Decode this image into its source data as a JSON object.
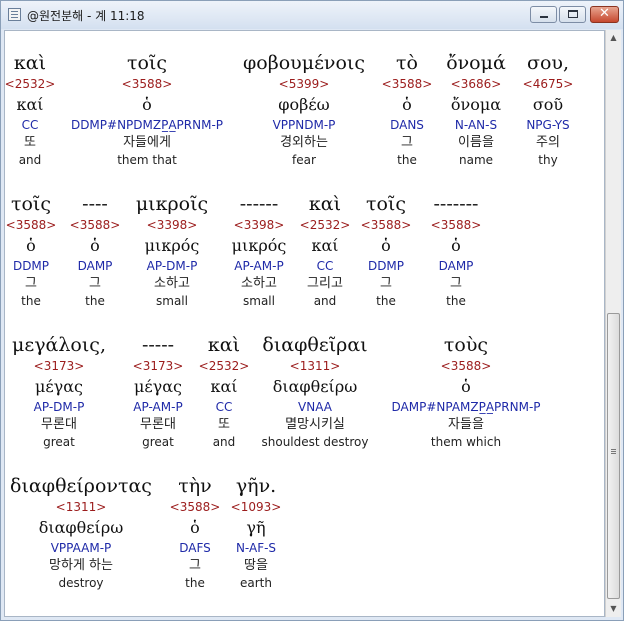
{
  "window": {
    "title": "@원전분해 - 계 11:18"
  },
  "rows": [
    [
      {
        "greek": "καὶ",
        "strong": "<2532>",
        "lemma": "καί",
        "parse": "CC",
        "korean": "또",
        "english": "and"
      },
      {
        "greek": "τοῖς",
        "strong": "<3588>",
        "lemma": "ὁ",
        "parse": "DDMP#NPDMZP̲A̲PRNM-P",
        "korean": "자들에게",
        "english": "them that"
      },
      {
        "greek": "φοβουμένοις",
        "strong": "<5399>",
        "lemma": "φοβέω",
        "parse": "VPPNDM-P",
        "korean": "경외하는",
        "english": "fear"
      },
      {
        "greek": "τὸ",
        "strong": "<3588>",
        "lemma": "ὁ",
        "parse": "DANS",
        "korean": "그",
        "english": "the"
      },
      {
        "greek": "ὄνομά",
        "strong": "<3686>",
        "lemma": "ὄνομα",
        "parse": "N-AN-S",
        "korean": "이름을",
        "english": "name"
      },
      {
        "greek": "σου,",
        "strong": "<4675>",
        "lemma": "σοῦ",
        "parse": "NPG-YS",
        "korean": "주의",
        "english": "thy"
      }
    ],
    [
      {
        "greek": "τοῖς",
        "strong": "<3588>",
        "lemma": "ὁ",
        "parse": "DDMP",
        "korean": "그",
        "english": "the"
      },
      {
        "greek": "----",
        "strong": "<3588>",
        "lemma": "ὁ",
        "parse": "DAMP",
        "korean": "그",
        "english": "the"
      },
      {
        "greek": "μικροῖς",
        "strong": "<3398>",
        "lemma": "μικρός",
        "parse": "AP-DM-P",
        "korean": "소하고",
        "english": "small"
      },
      {
        "greek": "------",
        "strong": "<3398>",
        "lemma": "μικρός",
        "parse": "AP-AM-P",
        "korean": "소하고",
        "english": "small"
      },
      {
        "greek": "καὶ",
        "strong": "<2532>",
        "lemma": "καί",
        "parse": "CC",
        "korean": "그리고",
        "english": "and"
      },
      {
        "greek": "τοῖς",
        "strong": "<3588>",
        "lemma": "ὁ",
        "parse": "DDMP",
        "korean": "그",
        "english": "the"
      },
      {
        "greek": "-------",
        "strong": "<3588>",
        "lemma": "ὁ",
        "parse": "DAMP",
        "korean": "그",
        "english": "the"
      }
    ],
    [
      {
        "greek": "μεγάλοις,",
        "strong": "<3173>",
        "lemma": "μέγας",
        "parse": "AP-DM-P",
        "korean": "무론대",
        "english": "great"
      },
      {
        "greek": "-----",
        "strong": "<3173>",
        "lemma": "μέγας",
        "parse": "AP-AM-P",
        "korean": "무론대",
        "english": "great"
      },
      {
        "greek": "καὶ",
        "strong": "<2532>",
        "lemma": "καί",
        "parse": "CC",
        "korean": "또",
        "english": "and"
      },
      {
        "greek": "διαφθεῖραι",
        "strong": "<1311>",
        "lemma": "διαφθείρω",
        "parse": "VNAA",
        "korean": "멸망시키실",
        "english": "shouldest destroy"
      },
      {
        "greek": "τοὺς",
        "strong": "<3588>",
        "lemma": "ὁ",
        "parse": "DAMP#NPAMZP̲A̲PRNM-P",
        "korean": "자들을",
        "english": "them which"
      }
    ],
    [
      {
        "greek": "διαφθείροντας",
        "strong": "<1311>",
        "lemma": "διαφθείρω",
        "parse": "VPPAAM-P",
        "korean": "망하게 하는",
        "english": "destroy"
      },
      {
        "greek": "τὴν",
        "strong": "<3588>",
        "lemma": "ὁ",
        "parse": "DAFS",
        "korean": "그",
        "english": "the"
      },
      {
        "greek": "γῆν.",
        "strong": "<1093>",
        "lemma": "γῆ",
        "parse": "N-AF-S",
        "korean": "땅을",
        "english": "earth"
      }
    ]
  ]
}
